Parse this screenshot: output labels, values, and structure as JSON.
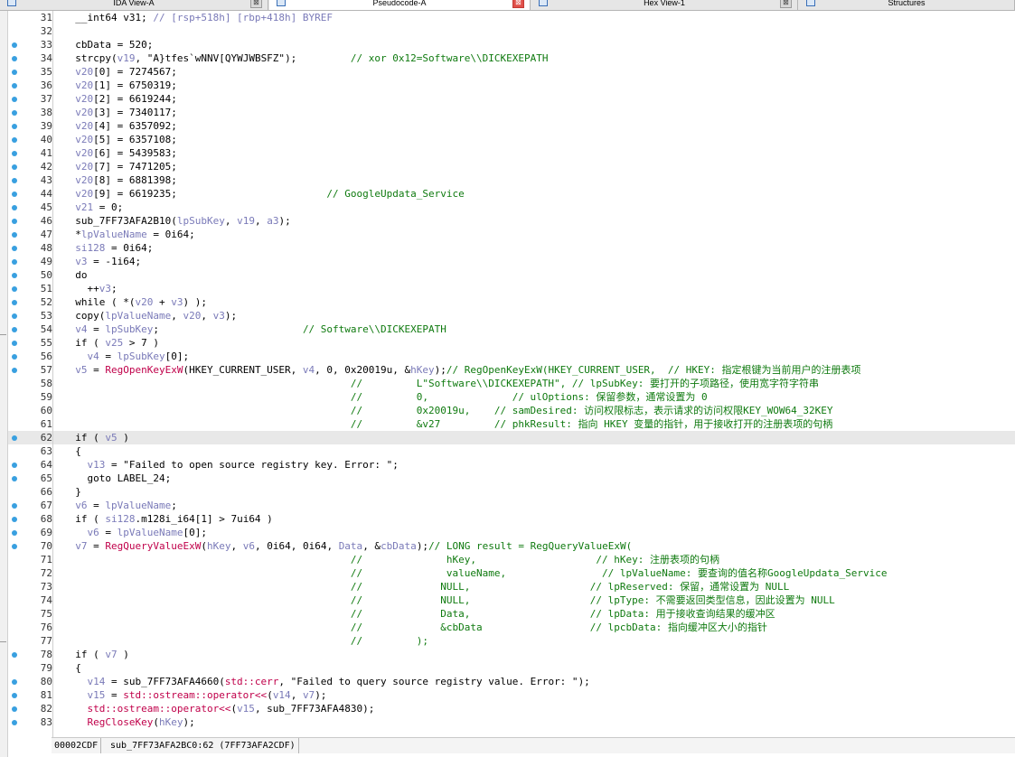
{
  "tabs": [
    {
      "label": "IDA View-A",
      "close": "⊠"
    },
    {
      "label": "Pseudocode-A",
      "close": "⊠",
      "active": true
    },
    {
      "label": "Hex View-1",
      "close": "⊠"
    },
    {
      "label": "Structures",
      "close": ""
    }
  ],
  "status": {
    "offset": "00002CDF",
    "location": "sub_7FF73AFA2BC0:62 (7FF73AFA2CDF)"
  },
  "colors": {
    "variable": "#7a7ab8",
    "function": "#c0004a",
    "comment": "#0f7a0f",
    "highlight": "#e8e8e8",
    "bullet": "#39a0e0"
  },
  "lines": [
    {
      "n": "31",
      "dot": false,
      "p": [
        [
          "n",
          "  __int64 v31; "
        ],
        [
          "v",
          "// [rsp+518h] [rbp+418h] BYREF"
        ]
      ]
    },
    {
      "n": "32",
      "dot": false,
      "p": []
    },
    {
      "n": "33",
      "dot": true,
      "p": [
        [
          "n",
          "  cbData = 520;"
        ]
      ]
    },
    {
      "n": "34",
      "dot": true,
      "p": [
        [
          "n",
          "  strcpy("
        ],
        [
          "v",
          "v19"
        ],
        [
          "n",
          ", "
        ],
        [
          "s",
          "\"A}tfes`wNNV[QYWJWBSFZ\""
        ],
        [
          "n",
          ");         "
        ],
        [
          "c",
          "// xor 0x12=Software\\\\DICKEXEPATH"
        ]
      ]
    },
    {
      "n": "35",
      "dot": true,
      "p": [
        [
          "v",
          "  v20"
        ],
        [
          "n",
          "[0] = 7274567;"
        ]
      ]
    },
    {
      "n": "36",
      "dot": true,
      "p": [
        [
          "v",
          "  v20"
        ],
        [
          "n",
          "[1] = 6750319;"
        ]
      ]
    },
    {
      "n": "37",
      "dot": true,
      "p": [
        [
          "v",
          "  v20"
        ],
        [
          "n",
          "[2] = 6619244;"
        ]
      ]
    },
    {
      "n": "38",
      "dot": true,
      "p": [
        [
          "v",
          "  v20"
        ],
        [
          "n",
          "[3] = 7340117;"
        ]
      ]
    },
    {
      "n": "39",
      "dot": true,
      "p": [
        [
          "v",
          "  v20"
        ],
        [
          "n",
          "[4] = 6357092;"
        ]
      ]
    },
    {
      "n": "40",
      "dot": true,
      "p": [
        [
          "v",
          "  v20"
        ],
        [
          "n",
          "[5] = 6357108;"
        ]
      ]
    },
    {
      "n": "41",
      "dot": true,
      "p": [
        [
          "v",
          "  v20"
        ],
        [
          "n",
          "[6] = 5439583;"
        ]
      ]
    },
    {
      "n": "42",
      "dot": true,
      "p": [
        [
          "v",
          "  v20"
        ],
        [
          "n",
          "[7] = 7471205;"
        ]
      ]
    },
    {
      "n": "43",
      "dot": true,
      "p": [
        [
          "v",
          "  v20"
        ],
        [
          "n",
          "[8] = 6881398;"
        ]
      ]
    },
    {
      "n": "44",
      "dot": true,
      "p": [
        [
          "v",
          "  v20"
        ],
        [
          "n",
          "[9] = 6619235;                         "
        ],
        [
          "c",
          "// GoogleUpdata_Service"
        ]
      ]
    },
    {
      "n": "45",
      "dot": true,
      "p": [
        [
          "v",
          "  v21"
        ],
        [
          "n",
          " = 0;"
        ]
      ]
    },
    {
      "n": "46",
      "dot": true,
      "p": [
        [
          "n",
          "  sub_7FF73AFA2B10("
        ],
        [
          "v",
          "lpSubKey"
        ],
        [
          "n",
          ", "
        ],
        [
          "v",
          "v19"
        ],
        [
          "n",
          ", "
        ],
        [
          "v",
          "a3"
        ],
        [
          "n",
          ");"
        ]
      ]
    },
    {
      "n": "47",
      "dot": true,
      "p": [
        [
          "n",
          "  *"
        ],
        [
          "v",
          "lpValueName"
        ],
        [
          "n",
          " = 0i64;"
        ]
      ]
    },
    {
      "n": "48",
      "dot": true,
      "p": [
        [
          "v",
          "  si128"
        ],
        [
          "n",
          " = 0i64;"
        ]
      ]
    },
    {
      "n": "49",
      "dot": true,
      "p": [
        [
          "v",
          "  v3"
        ],
        [
          "n",
          " = -1i64;"
        ]
      ]
    },
    {
      "n": "50",
      "dot": true,
      "p": [
        [
          "n",
          "  do"
        ]
      ]
    },
    {
      "n": "51",
      "dot": true,
      "p": [
        [
          "n",
          "    ++"
        ],
        [
          "v",
          "v3"
        ],
        [
          "n",
          ";"
        ]
      ]
    },
    {
      "n": "52",
      "dot": true,
      "p": [
        [
          "n",
          "  while ( *("
        ],
        [
          "v",
          "v20"
        ],
        [
          "n",
          " + "
        ],
        [
          "v",
          "v3"
        ],
        [
          "n",
          ") );"
        ]
      ]
    },
    {
      "n": "53",
      "dot": true,
      "p": [
        [
          "n",
          "  copy("
        ],
        [
          "v",
          "lpValueName"
        ],
        [
          "n",
          ", "
        ],
        [
          "v",
          "v20"
        ],
        [
          "n",
          ", "
        ],
        [
          "v",
          "v3"
        ],
        [
          "n",
          ");"
        ]
      ]
    },
    {
      "n": "54",
      "dot": true,
      "p": [
        [
          "v",
          "  v4"
        ],
        [
          "n",
          " = "
        ],
        [
          "v",
          "lpSubKey"
        ],
        [
          "n",
          ";                        "
        ],
        [
          "c",
          "// Software\\\\DICKEXEPATH"
        ]
      ]
    },
    {
      "n": "55",
      "dot": true,
      "p": [
        [
          "n",
          "  if ( "
        ],
        [
          "v",
          "v25"
        ],
        [
          "n",
          " > 7 )"
        ]
      ]
    },
    {
      "n": "56",
      "dot": true,
      "p": [
        [
          "v",
          "    v4"
        ],
        [
          "n",
          " = "
        ],
        [
          "v",
          "lpSubKey"
        ],
        [
          "n",
          "[0];"
        ]
      ]
    },
    {
      "n": "57",
      "dot": true,
      "p": [
        [
          "v",
          "  v5"
        ],
        [
          "n",
          " = "
        ],
        [
          "f",
          "RegOpenKeyExW"
        ],
        [
          "n",
          "(HKEY_CURRENT_USER, "
        ],
        [
          "v",
          "v4"
        ],
        [
          "n",
          ", 0, 0x20019u, &"
        ],
        [
          "v",
          "hKey"
        ],
        [
          "n",
          ");"
        ],
        [
          "c",
          "// RegOpenKeyExW(HKEY_CURRENT_USER,  // HKEY: 指定根键为当前用户的注册表项"
        ]
      ]
    },
    {
      "n": "58",
      "dot": false,
      "p": [
        [
          "c",
          "                                                //         L\"Software\\\\DICKEXEPATH\", // lpSubKey: 要打开的子项路径，使用宽字符字符串"
        ]
      ]
    },
    {
      "n": "59",
      "dot": false,
      "p": [
        [
          "c",
          "                                                //         0,              // ulOptions: 保留参数，通常设置为 0"
        ]
      ]
    },
    {
      "n": "60",
      "dot": false,
      "p": [
        [
          "c",
          "                                                //         0x20019u,    // samDesired: 访问权限标志，表示请求的访问权限KEY_WOW64_32KEY"
        ]
      ]
    },
    {
      "n": "61",
      "dot": false,
      "p": [
        [
          "c",
          "                                                //         &v27         // phkResult: 指向 HKEY 变量的指针，用于接收打开的注册表项的句柄"
        ]
      ]
    },
    {
      "n": "62",
      "dot": true,
      "hl": true,
      "p": [
        [
          "n",
          "  if ( "
        ],
        [
          "v",
          "v5"
        ],
        [
          "n",
          " )"
        ]
      ]
    },
    {
      "n": "63",
      "dot": false,
      "p": [
        [
          "n",
          "  {"
        ]
      ]
    },
    {
      "n": "64",
      "dot": true,
      "p": [
        [
          "v",
          "    v13"
        ],
        [
          "n",
          " = "
        ],
        [
          "s",
          "\"Failed to open source registry key. Error: \""
        ],
        [
          "n",
          ";"
        ]
      ]
    },
    {
      "n": "65",
      "dot": true,
      "p": [
        [
          "n",
          "    goto LABEL_24;"
        ]
      ]
    },
    {
      "n": "66",
      "dot": false,
      "p": [
        [
          "n",
          "  }"
        ]
      ]
    },
    {
      "n": "67",
      "dot": true,
      "p": [
        [
          "v",
          "  v6"
        ],
        [
          "n",
          " = "
        ],
        [
          "v",
          "lpValueName"
        ],
        [
          "n",
          ";"
        ]
      ]
    },
    {
      "n": "68",
      "dot": true,
      "p": [
        [
          "n",
          "  if ( "
        ],
        [
          "v",
          "si128"
        ],
        [
          "n",
          ".m128i_i64[1] > 7ui64 )"
        ]
      ]
    },
    {
      "n": "69",
      "dot": true,
      "p": [
        [
          "v",
          "    v6"
        ],
        [
          "n",
          " = "
        ],
        [
          "v",
          "lpValueName"
        ],
        [
          "n",
          "[0];"
        ]
      ]
    },
    {
      "n": "70",
      "dot": true,
      "p": [
        [
          "v",
          "  v7"
        ],
        [
          "n",
          " = "
        ],
        [
          "f",
          "RegQueryValueExW"
        ],
        [
          "n",
          "("
        ],
        [
          "v",
          "hKey"
        ],
        [
          "n",
          ", "
        ],
        [
          "v",
          "v6"
        ],
        [
          "n",
          ", 0i64, 0i64, "
        ],
        [
          "v",
          "Data"
        ],
        [
          "n",
          ", &"
        ],
        [
          "v",
          "cbData"
        ],
        [
          "n",
          ");"
        ],
        [
          "c",
          "// LONG result = RegQueryValueExW("
        ]
      ]
    },
    {
      "n": "71",
      "dot": false,
      "p": [
        [
          "c",
          "                                                //              hKey,                    // hKey: 注册表项的句柄"
        ]
      ]
    },
    {
      "n": "72",
      "dot": false,
      "p": [
        [
          "c",
          "                                                //              valueName,                // lpValueName: 要查询的值名称GoogleUpdata_Service"
        ]
      ]
    },
    {
      "n": "73",
      "dot": false,
      "p": [
        [
          "c",
          "                                                //             NULL,                    // lpReserved: 保留，通常设置为 NULL"
        ]
      ]
    },
    {
      "n": "74",
      "dot": false,
      "p": [
        [
          "c",
          "                                                //             NULL,                    // lpType: 不需要返回类型信息，因此设置为 NULL"
        ]
      ]
    },
    {
      "n": "75",
      "dot": false,
      "p": [
        [
          "c",
          "                                                //             Data,                    // lpData: 用于接收查询结果的缓冲区"
        ]
      ]
    },
    {
      "n": "76",
      "dot": false,
      "p": [
        [
          "c",
          "                                                //             &cbData                  // lpcbData: 指向缓冲区大小的指针"
        ]
      ]
    },
    {
      "n": "77",
      "dot": false,
      "p": [
        [
          "c",
          "                                                //         );"
        ]
      ]
    },
    {
      "n": "78",
      "dot": true,
      "p": [
        [
          "n",
          "  if ( "
        ],
        [
          "v",
          "v7"
        ],
        [
          "n",
          " )"
        ]
      ]
    },
    {
      "n": "79",
      "dot": false,
      "p": [
        [
          "n",
          "  {"
        ]
      ]
    },
    {
      "n": "80",
      "dot": true,
      "p": [
        [
          "v",
          "    v14"
        ],
        [
          "n",
          " = sub_7FF73AFA4660("
        ],
        [
          "f",
          "std::cerr"
        ],
        [
          "n",
          ", "
        ],
        [
          "s",
          "\"Failed to query source registry value. Error: \""
        ],
        [
          "n",
          ");"
        ]
      ]
    },
    {
      "n": "81",
      "dot": true,
      "p": [
        [
          "v",
          "    v15"
        ],
        [
          "n",
          " = "
        ],
        [
          "f",
          "std::ostream::operator<<"
        ],
        [
          "n",
          "("
        ],
        [
          "v",
          "v14"
        ],
        [
          "n",
          ", "
        ],
        [
          "v",
          "v7"
        ],
        [
          "n",
          ");"
        ]
      ]
    },
    {
      "n": "82",
      "dot": true,
      "p": [
        [
          "f",
          "    std::ostream::operator<<"
        ],
        [
          "n",
          "("
        ],
        [
          "v",
          "v15"
        ],
        [
          "n",
          ", sub_7FF73AFA4830);"
        ]
      ]
    },
    {
      "n": "83",
      "dot": true,
      "p": [
        [
          "f",
          "    RegCloseKey"
        ],
        [
          "n",
          "("
        ],
        [
          "v",
          "hKey"
        ],
        [
          "n",
          ");"
        ]
      ]
    }
  ]
}
